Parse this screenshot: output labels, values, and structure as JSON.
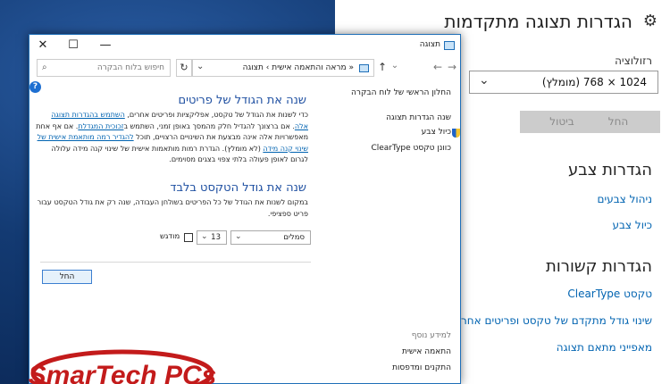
{
  "settings": {
    "title": "הגדרות תצוגה מתקדמות",
    "resolution_label": "רזולוציה",
    "resolution_value": "1024 × 768 (מומלץ)",
    "apply_label": "החל",
    "cancel_label": "ביטול",
    "color_heading": "הגדרות צבע",
    "color_links": [
      "ניהול צבעים",
      "כיול צבע"
    ],
    "related_heading": "הגדרות קשורות",
    "related_links": [
      "טקסט ClearType",
      "שינוי גודל מתקדם של טקסט ופריטים אחרים",
      "מאפייני מתאם תצוגה"
    ]
  },
  "display_window": {
    "title": "תצוגה",
    "breadcrumb": "«  מראה והתאמה אישית  ›  תצוגה",
    "search_placeholder": "חיפוש בלוח הבקרה",
    "help_icon": "?",
    "nav": {
      "home": "החלון הראשי של לוח הבקרה",
      "items": [
        "שנה הגדרות תצוגה",
        "כיול צבע",
        "כוונן טקסט ClearType"
      ],
      "see_also_heading": "למידע נוסף",
      "see_also": [
        "התאמה אישית",
        "התקנים ומדפסות"
      ]
    },
    "section1": {
      "heading": "שנה את הגודל של פריטים",
      "text_before_link1": "כדי לשנות את הגודל של טקסט, אפליקציות ופריטים אחרים, ",
      "link1": "השתמש בהגדרות תצוגה אלה",
      "text_mid": ". אם ברצונך להגדיל חלק מהמסך באופן זמני, השתמש ב",
      "link2": "זכוכית המגדלת",
      "text_mid2": ". אם אף אחת מאפשרויות אלה אינה מבצעת את השינויים הרצויים, תוכל ",
      "link3": "להגדיר רמה מותאמת אישית של שינוי קנה מידה",
      "text_end": " (לא מומלץ). הגדרת רמות מותאמות אישית של שינוי קנה מידה עלולה לגרום לאופן פעולה בלתי צפוי בצגים מסוימים."
    },
    "section2": {
      "heading": "שנה את גודל הטקסט בלבד",
      "text": "במקום לשנות את הגודל של כל הפריטים בשולחן העבודה, שנה רק את גודל הטקסט עבור פריט ספציפי.",
      "item_select": "סמלים",
      "size_select": "13",
      "bold_label": "מודגש"
    },
    "apply_label": "החל"
  },
  "watermark": {
    "text": "SmarTech PCs"
  }
}
